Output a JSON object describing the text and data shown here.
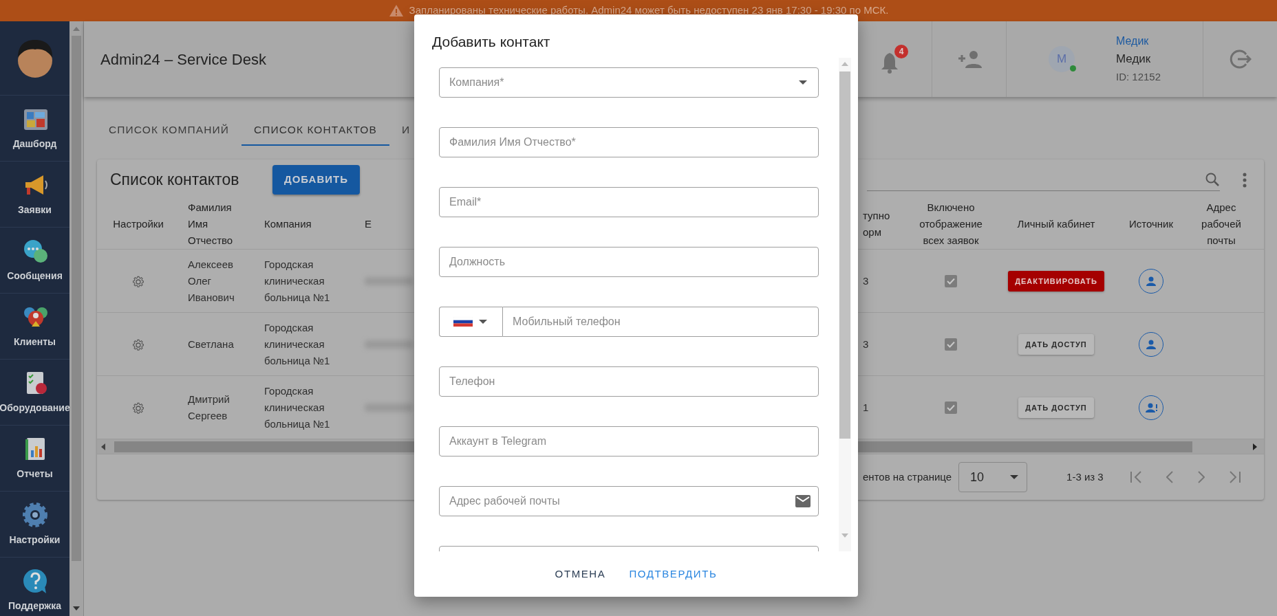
{
  "banner": {
    "text": "Запланированы технические работы. Admin24 может быть недоступен 23 янв 17:30 - 19:30 по МСК."
  },
  "sidebar": {
    "items": [
      {
        "label": "Дашборд",
        "kind": "dashboard"
      },
      {
        "label": "Заявки",
        "kind": "tickets"
      },
      {
        "label": "Сообщения",
        "kind": "messages"
      },
      {
        "label": "Клиенты",
        "kind": "clients"
      },
      {
        "label": "Оборудование",
        "kind": "equipment"
      },
      {
        "label": "Отчеты",
        "kind": "reports"
      },
      {
        "label": "Настройки",
        "kind": "settings"
      },
      {
        "label": "Поддержка",
        "kind": "support"
      }
    ]
  },
  "header": {
    "title": "Admin24 – Service Desk",
    "notifications": "4",
    "user": {
      "initial": "М",
      "link": "Медик",
      "name": "Медик",
      "id": "ID: 12152",
      "online": true
    }
  },
  "tabs": [
    {
      "label": "СПИСОК КОМПАНИЙ",
      "selected": false
    },
    {
      "label": "СПИСОК КОНТАКТОВ",
      "selected": true
    },
    {
      "label": "И",
      "selected": false
    }
  ],
  "contacts": {
    "title": "Список контактов",
    "add_button": "ДОБАВИТЬ",
    "columns_left": [
      "Настройки",
      "Фамилия Имя Отчество",
      "Компания",
      "E"
    ],
    "columns_right": [
      "тупно орм",
      "Включено отображение всех заявок",
      "Личный кабинет",
      "Источник",
      "Адрес рабочей почты"
    ],
    "rows": [
      {
        "name": "Алексеев Олег Иванович",
        "company": "Городская клиническая больница №1",
        "column_count": "3",
        "show_all": true,
        "access": {
          "kind": "deactivate",
          "label": "ДЕАКТИВИРОВАТЬ"
        },
        "source": {
          "kind": "user"
        }
      },
      {
        "name": "Светлана",
        "company": "Городская клиническая больница №1",
        "column_count": "3",
        "show_all": true,
        "access": {
          "kind": "grant",
          "label": "ДАТЬ ДОСТУП"
        },
        "source": {
          "kind": "user"
        }
      },
      {
        "name": "Дмитрий Сергеев",
        "company": "Городская клиническая больница №1",
        "column_count": "1",
        "show_all": true,
        "access": {
          "kind": "grant",
          "label": "ДАТЬ ДОСТУП"
        },
        "source": {
          "kind": "user_alert"
        }
      }
    ],
    "pagination": {
      "per_page_label": "ентов на странице",
      "per_page": "10",
      "range": "1-3 из 3"
    }
  },
  "dialog": {
    "title": "Добавить контакт",
    "fields": [
      {
        "kind": "select",
        "placeholder": "Компания*"
      },
      {
        "kind": "text",
        "placeholder": "Фамилия Имя Отчество*"
      },
      {
        "kind": "text",
        "placeholder": "Email*"
      },
      {
        "kind": "text",
        "placeholder": "Должность"
      },
      {
        "kind": "phone",
        "placeholder": "Мобильный телефон"
      },
      {
        "kind": "text",
        "placeholder": "Телефон"
      },
      {
        "kind": "text",
        "placeholder": "Аккаунт в Telegram"
      },
      {
        "kind": "email",
        "placeholder": "Адрес рабочей почты"
      },
      {
        "kind": "partial"
      }
    ],
    "buttons": [
      {
        "label": "ОТМЕНА",
        "kind": "secondary"
      },
      {
        "label": "ПОДТВЕРДИТЬ",
        "kind": "primary"
      }
    ]
  }
}
